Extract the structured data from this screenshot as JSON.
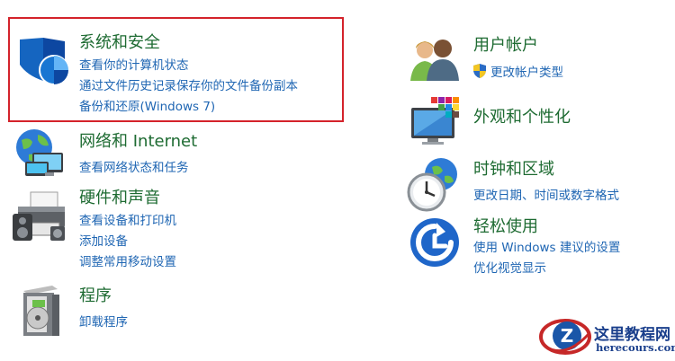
{
  "categories": {
    "system_security": {
      "title": "系统和安全",
      "links": [
        "查看你的计算机状态",
        "通过文件历史记录保存你的文件备份副本",
        "备份和还原(Windows 7)"
      ],
      "icon": "shield-icon"
    },
    "network": {
      "title": "网络和 Internet",
      "links": [
        "查看网络状态和任务"
      ],
      "icon": "globe-network-icon"
    },
    "hardware": {
      "title": "硬件和声音",
      "links": [
        "查看设备和打印机",
        "添加设备",
        "调整常用移动设置"
      ],
      "icon": "printer-icon"
    },
    "programs": {
      "title": "程序",
      "links": [
        "卸载程序"
      ],
      "icon": "programs-disc-icon"
    },
    "user_accounts": {
      "title": "用户帐户",
      "links": [
        "更改帐户类型"
      ],
      "icon": "users-icon"
    },
    "appearance": {
      "title": "外观和个性化",
      "links": [],
      "icon": "monitor-palette-icon"
    },
    "clock_region": {
      "title": "时钟和区域",
      "links": [
        "更改日期、时间或数字格式"
      ],
      "icon": "clock-globe-icon"
    },
    "ease_access": {
      "title": "轻松使用",
      "links": [
        "使用 Windows 建议的设置",
        "优化视觉显示"
      ],
      "icon": "ease-of-access-icon"
    }
  },
  "watermark": {
    "title": "这里教程网",
    "url": "herecours.com",
    "letter": "Z"
  },
  "colors": {
    "title_green": "#1e6b32",
    "link_blue": "#1f66b3",
    "highlight_red": "#d4232b"
  }
}
